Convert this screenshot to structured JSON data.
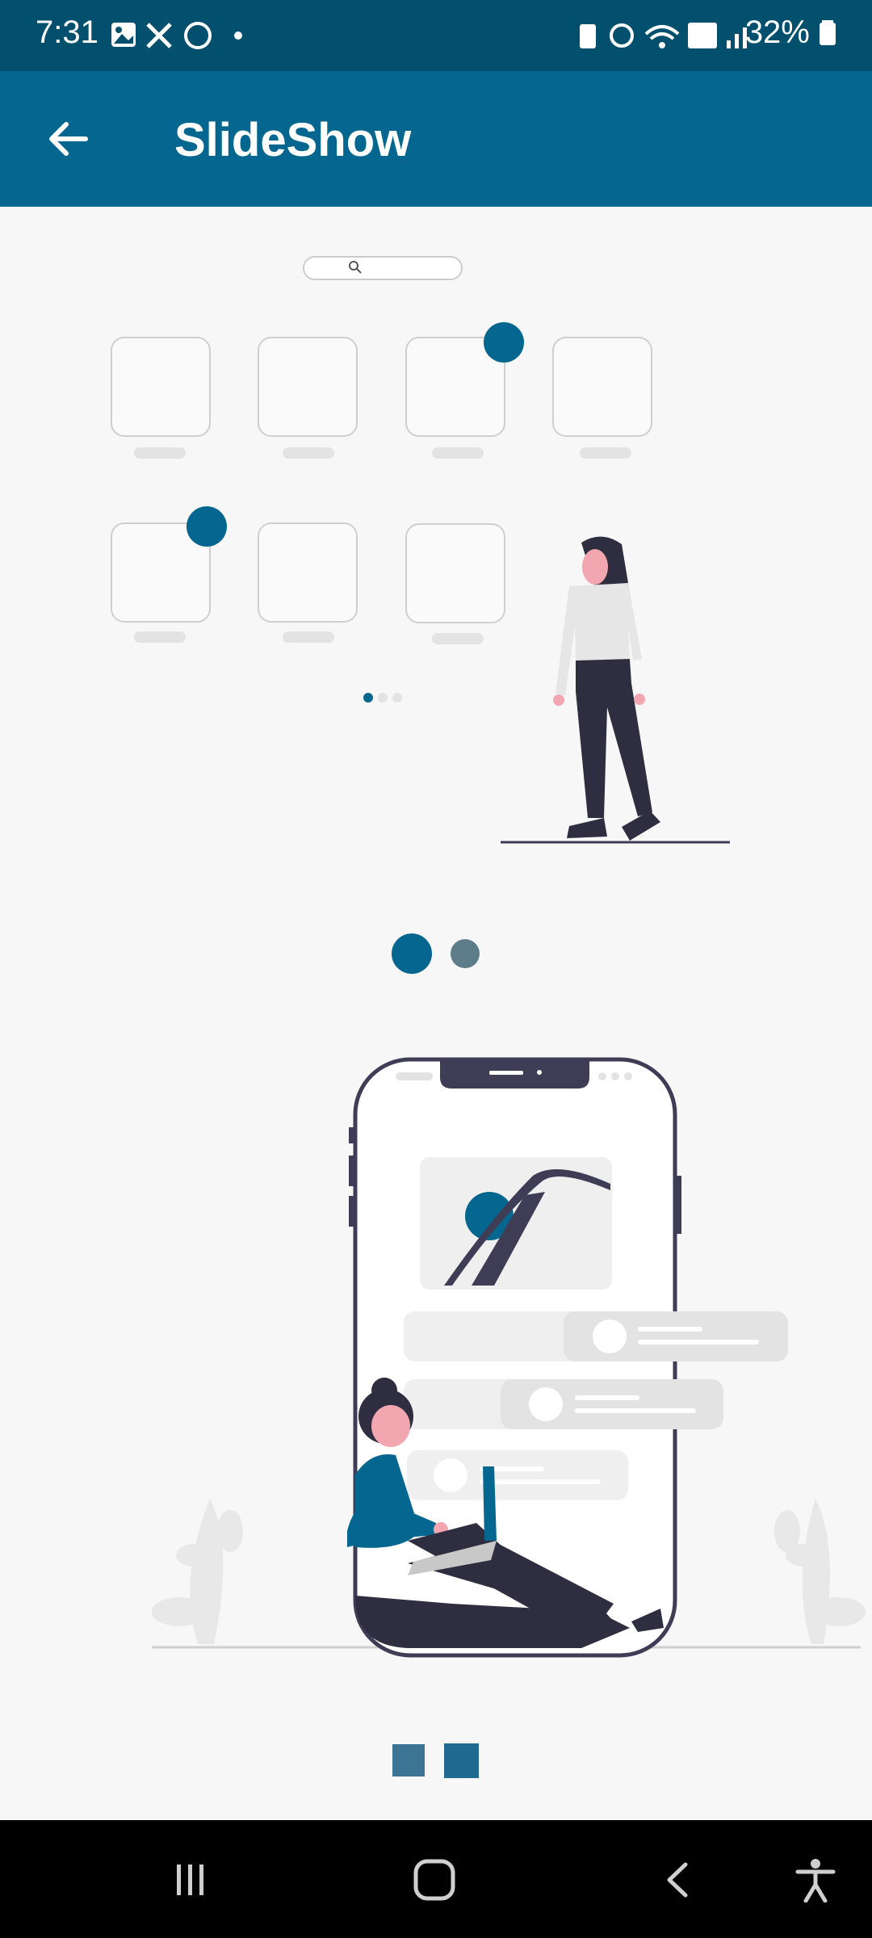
{
  "status_bar": {
    "time": "7:31",
    "battery": "32%"
  },
  "app_bar": {
    "title": "SlideShow"
  },
  "colors": {
    "status_bar": "#034f6e",
    "app_bar": "#05678f",
    "accent": "#05678f",
    "dot_inactive": "#5e7d8a",
    "square_1": "#3c7593",
    "square_2": "#20698f",
    "background": "#f7f7f7",
    "nav_bar": "#000000"
  },
  "slides": [
    {
      "illustration": "app-grid-with-woman"
    },
    {
      "illustration": "phone-with-seated-woman"
    }
  ],
  "pager": {
    "count": 2,
    "active_index": 0
  },
  "bottom_indicators": {
    "count": 2
  },
  "icons": {
    "back": "arrow-left-icon",
    "nav_recents": "recents-icon",
    "nav_home": "home-icon",
    "nav_back": "chevron-left-icon",
    "nav_accessibility": "accessibility-icon"
  }
}
